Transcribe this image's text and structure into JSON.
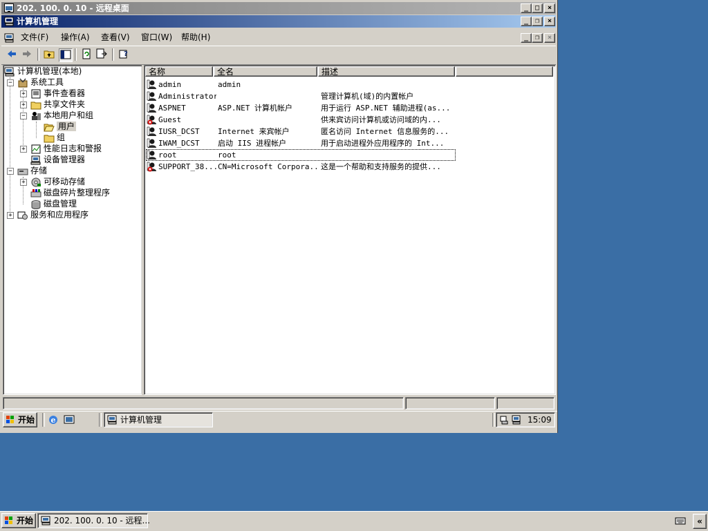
{
  "rdp": {
    "title": "202. 100. 0. 10 - 远程桌面"
  },
  "mmc": {
    "title": "计算机管理",
    "menu": [
      "文件(F)",
      "操作(A)",
      "查看(V)",
      "窗口(W)",
      "帮助(H)"
    ]
  },
  "tree": {
    "root": "计算机管理(本地)",
    "system_tools": "系统工具",
    "event_viewer": "事件查看器",
    "shared_folders": "共享文件夹",
    "local_users": "本地用户和组",
    "users": "用户",
    "groups": "组",
    "perf_logs": "性能日志和警报",
    "device_manager": "设备管理器",
    "storage": "存储",
    "removable_storage": "可移动存储",
    "defrag": "磁盘碎片整理程序",
    "disk_mgmt": "磁盘管理",
    "services_apps": "服务和应用程序"
  },
  "list": {
    "columns": [
      "名称",
      "全名",
      "描述"
    ],
    "rows": [
      {
        "name": "admin",
        "full": "admin",
        "desc": "",
        "disabled": false
      },
      {
        "name": "Administrator",
        "full": "",
        "desc": "管理计算机(域)的内置帐户",
        "disabled": false
      },
      {
        "name": "ASPNET",
        "full": "ASP.NET 计算机帐户",
        "desc": "用于运行 ASP.NET 辅助进程(as...",
        "disabled": false
      },
      {
        "name": "Guest",
        "full": "",
        "desc": "供来宾访问计算机或访问域的内...",
        "disabled": true
      },
      {
        "name": "IUSR_DCST",
        "full": "Internet 来宾帐户",
        "desc": "匿名访问 Internet 信息服务的...",
        "disabled": false
      },
      {
        "name": "IWAM_DCST",
        "full": "启动 IIS 进程帐户",
        "desc": "用于启动进程外应用程序的 Int...",
        "disabled": false
      },
      {
        "name": "root",
        "full": "root",
        "desc": "",
        "disabled": false
      },
      {
        "name": "SUPPORT_38...",
        "full": "CN=Microsoft Corpora...",
        "desc": "这是一个帮助和支持服务的提供...",
        "disabled": true
      }
    ]
  },
  "inner_taskbar": {
    "start": "开始",
    "task": "计算机管理",
    "clock": "15:09"
  },
  "outer_taskbar": {
    "start": "开始",
    "task": "202. 100. 0. 10 - 远程...",
    "chevron": "«"
  },
  "icons": [
    "back-icon",
    "forward-icon",
    "up-icon",
    "show-tree-icon",
    "refresh-icon",
    "export-icon",
    "help-icon",
    "computer-icon",
    "folder-icon",
    "user-icon",
    "user-disabled-icon",
    "ie-icon",
    "show-desktop-icon",
    "network-icon",
    "keyboard-icon"
  ],
  "colors": {
    "desktop": "#3a6ea5",
    "titlebar_active": "#0a246a",
    "titlebar_inactive": "#808080",
    "face": "#d4d0c8"
  }
}
